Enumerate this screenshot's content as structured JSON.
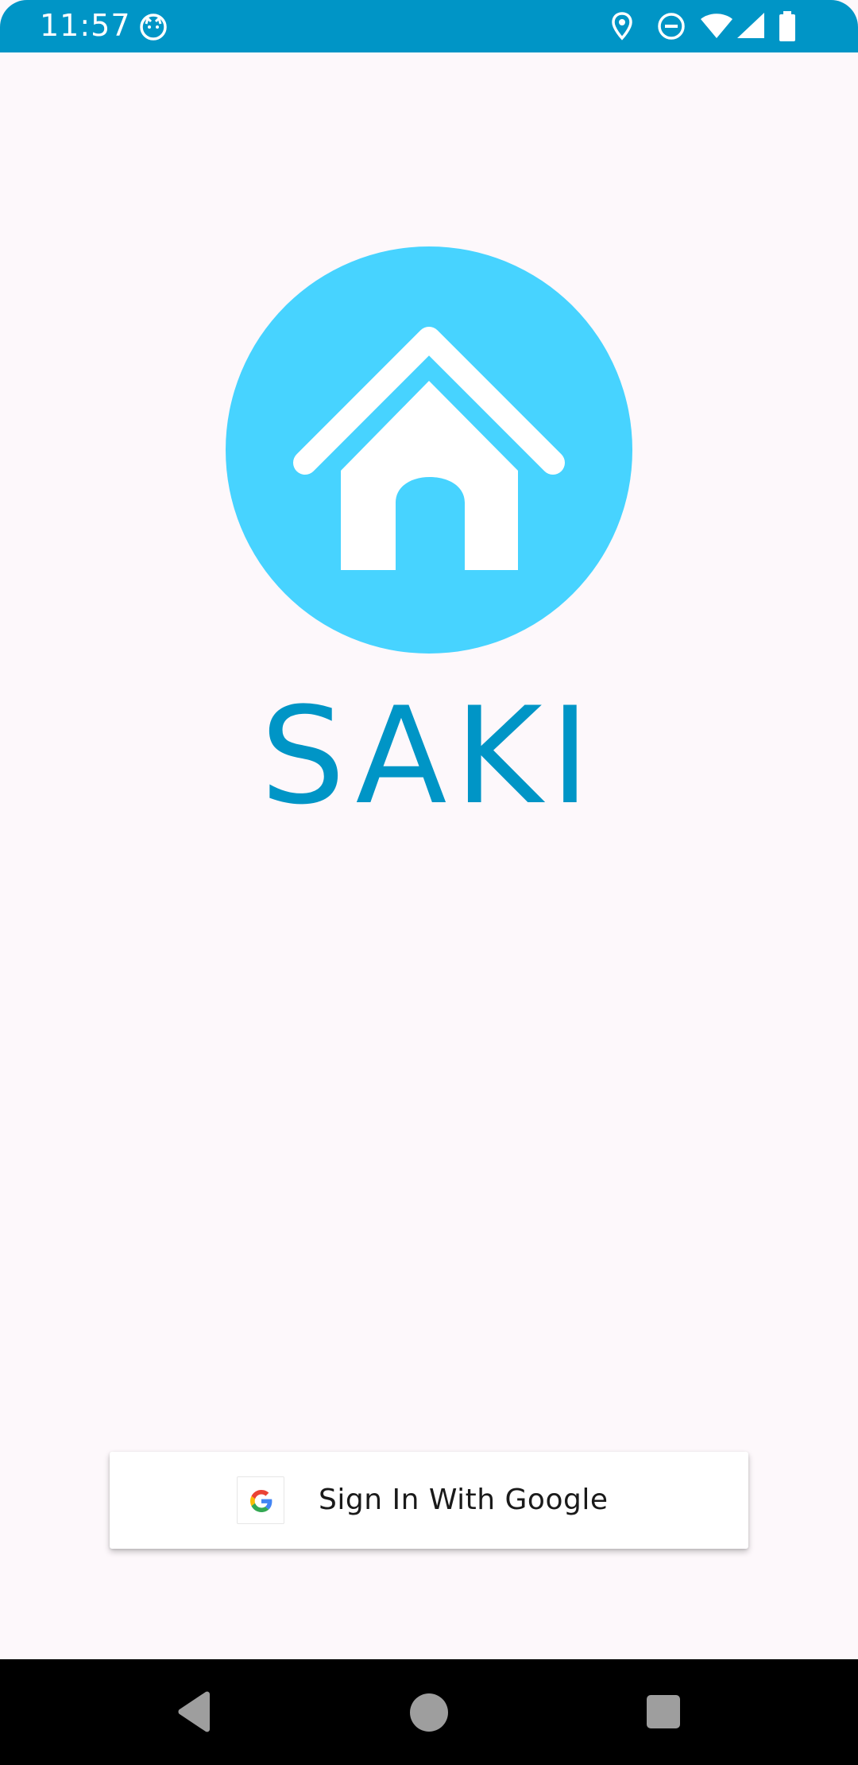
{
  "status_bar": {
    "time": "11:57",
    "icons": [
      "cat-face-icon",
      "location-icon",
      "do-not-disturb-icon",
      "wifi-icon",
      "cellular-signal-icon",
      "battery-icon"
    ]
  },
  "app": {
    "name": "SAKI",
    "logo_icon": "house-icon"
  },
  "signin": {
    "label": "Sign In With Google",
    "icon": "google-g-icon"
  },
  "nav": {
    "icons": [
      "back-icon",
      "home-icon",
      "recents-icon"
    ]
  },
  "colors": {
    "status_bar": "#0095c6",
    "title": "#0095c6",
    "logo_circle": "#47d3ff",
    "background": "#fdf8fb",
    "nav_bar": "#000000",
    "nav_icons": "#9e9e9e"
  }
}
